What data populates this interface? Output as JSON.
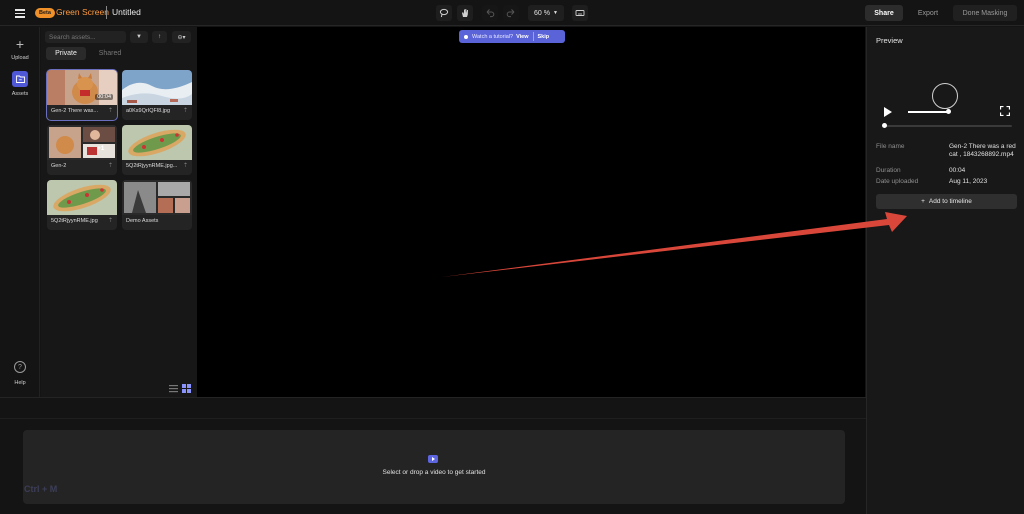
{
  "app": {
    "badge": "Beta",
    "name": "Green Screen",
    "document_title": "Untitled"
  },
  "toolbar": {
    "zoom": "60 %",
    "share_label": "Share",
    "export_label": "Export",
    "done_label": "Done Masking",
    "icons": [
      "lasso-icon",
      "hand-icon",
      "undo-icon",
      "redo-icon",
      "zoom-chevron-icon",
      "keyboard-icon"
    ]
  },
  "rail": {
    "upload_label": "Upload",
    "assets_label": "Assets",
    "help_label": "Help"
  },
  "assets": {
    "search_placeholder": "Search assets...",
    "tabs": [
      {
        "label": "Private",
        "active": true
      },
      {
        "label": "Shared",
        "active": false
      }
    ],
    "items": [
      {
        "label": "Gen-2 There was...",
        "duration": "00:04",
        "selected": true
      },
      {
        "label": "a0Ks9QrIQFl8.jpg"
      },
      {
        "label": "Gen-2",
        "extra_count": "+1"
      },
      {
        "label": "5Q2tRjyynRME.jpg..."
      },
      {
        "label": "5Q2tRjyynRME.jpg"
      },
      {
        "label": "Demo Assets"
      }
    ]
  },
  "canvas": {
    "tutorial_text": "Watch a tutorial?",
    "tutorial_view": "View",
    "tutorial_skip": "Skip"
  },
  "preview": {
    "title": "Preview",
    "file_name_label": "File name",
    "file_name_value": "Gen-2 There was a red cat , 1843268892.mp4",
    "duration_label": "Duration",
    "duration_value": "00:04",
    "date_label": "Date uploaded",
    "date_value": "Aug 11, 2023",
    "add_label": "Add to timeline"
  },
  "timeline": {
    "drop_text": "Select or drop a video to get started",
    "shortcut_hint": "Ctrl + M"
  },
  "colors": {
    "accent": "#5b63d9",
    "brand": "#ff9a3c",
    "annotation_arrow": "#d9473a"
  }
}
